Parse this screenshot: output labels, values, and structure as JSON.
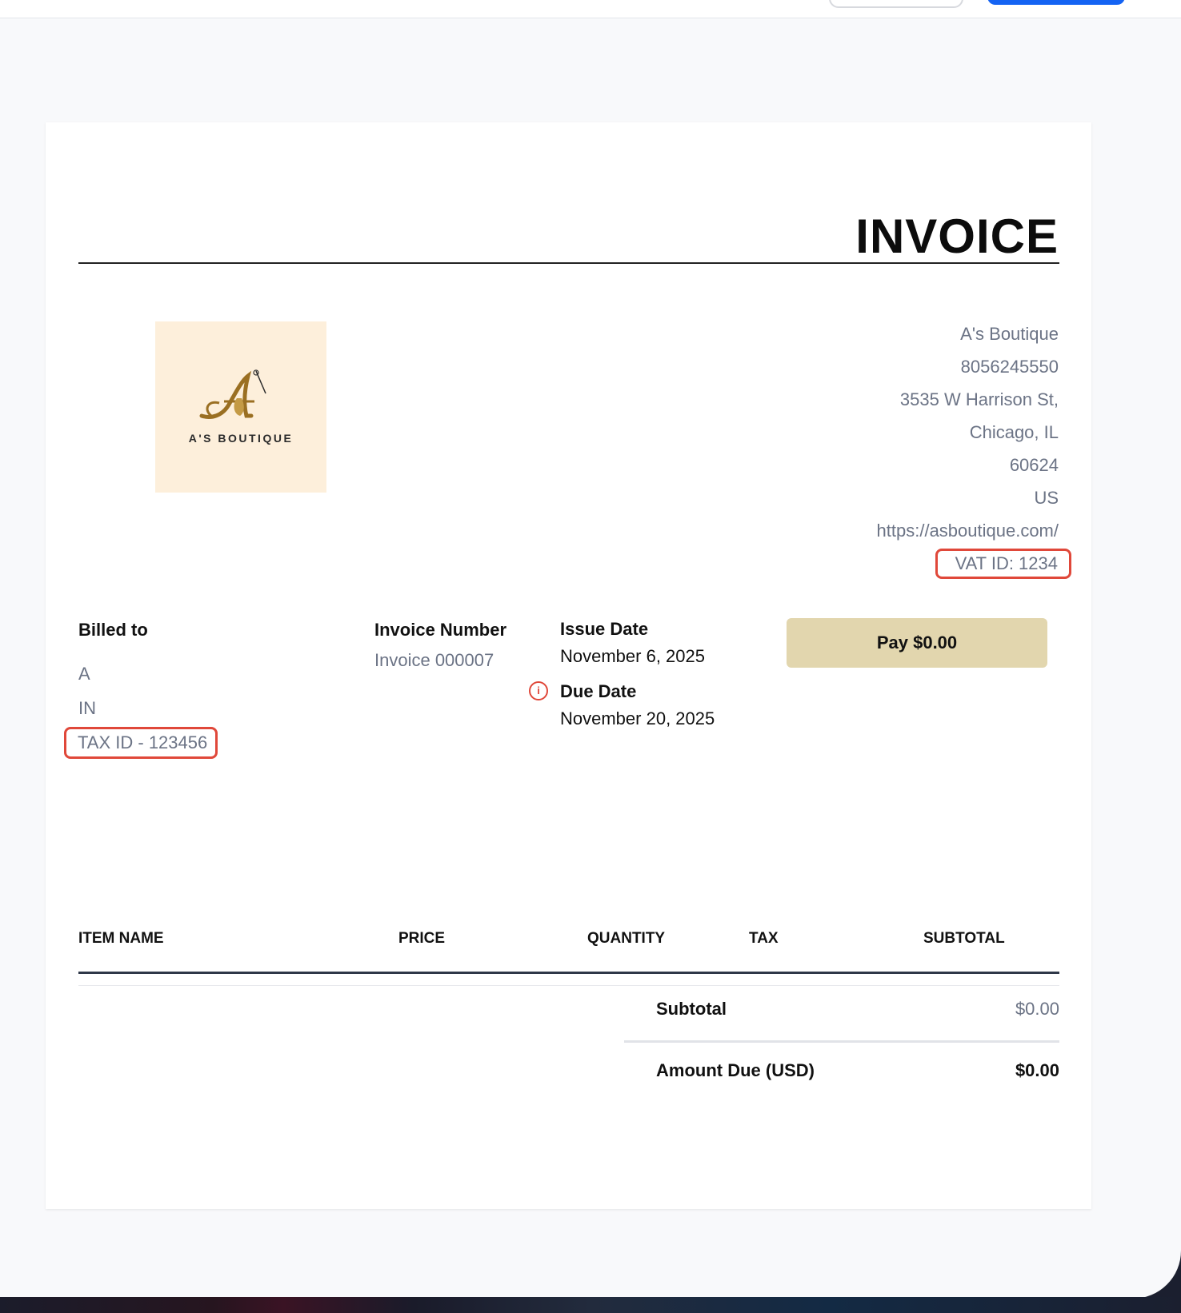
{
  "invoice": {
    "title": "INVOICE",
    "logo_text": "A'S BOUTIQUE",
    "seller": {
      "name": "A's Boutique",
      "phone": "8056245550",
      "street": "3535 W Harrison St,",
      "city": "Chicago, IL",
      "zip": "60624",
      "country": "US",
      "website": "https://asboutique.com/",
      "vat": "VAT ID: 1234"
    },
    "billed_to": {
      "label": "Billed to",
      "name": "A",
      "country": "IN",
      "tax_id": "TAX ID - 123456"
    },
    "invoice_number": {
      "label": "Invoice Number",
      "value": "Invoice 000007"
    },
    "issue_date": {
      "label": "Issue Date",
      "value": "November 6, 2025"
    },
    "due_date": {
      "label": "Due Date",
      "value": "November 20, 2025",
      "icon": "info-icon"
    },
    "pay_button": "Pay $0.00",
    "table": {
      "headers": [
        "ITEM NAME",
        "PRICE",
        "QUANTITY",
        "TAX",
        "SUBTOTAL"
      ],
      "rows": []
    },
    "totals": {
      "subtotal_label": "Subtotal",
      "subtotal_value": "$0.00",
      "amount_due_label": "Amount Due (USD)",
      "amount_due_value": "$0.00"
    }
  },
  "colors": {
    "accent_button": "#e2d6ae",
    "highlight": "#e0483a",
    "primary_top_button": "#1463f3",
    "muted_text": "#6b7385"
  }
}
